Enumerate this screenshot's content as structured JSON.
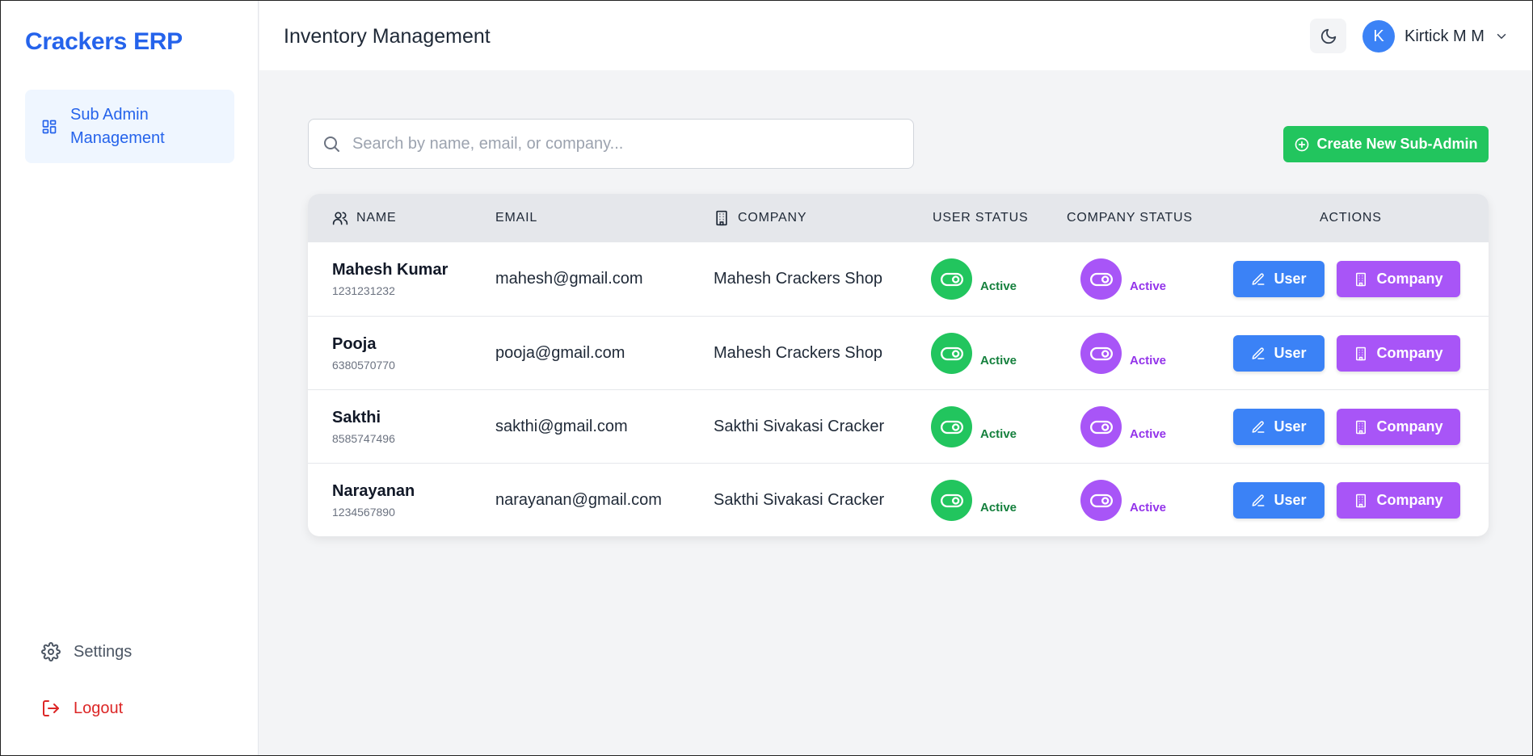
{
  "sidebar": {
    "brand": "Crackers ERP",
    "nav_label": "Sub Admin Management",
    "settings_label": "Settings",
    "logout_label": "Logout"
  },
  "header": {
    "title": "Inventory Management",
    "user_initial": "K",
    "user_name": "Kirtick M M"
  },
  "toolbar": {
    "search_placeholder": "Search by name, email, or company...",
    "search_value": "",
    "create_label": "Create New Sub-Admin"
  },
  "table": {
    "headers": {
      "name": "NAME",
      "email": "EMAIL",
      "company": "COMPANY",
      "user_status": "USER STATUS",
      "company_status": "COMPANY STATUS",
      "actions": "ACTIONS"
    },
    "user_button_label": "User",
    "company_button_label": "Company",
    "rows": [
      {
        "name": "Mahesh Kumar",
        "phone": "1231231232",
        "email": "mahesh@gmail.com",
        "company": "Mahesh Crackers Shop",
        "user_status": "Active",
        "company_status": "Active"
      },
      {
        "name": "Pooja",
        "phone": "6380570770",
        "email": "pooja@gmail.com",
        "company": "Mahesh Crackers Shop",
        "user_status": "Active",
        "company_status": "Active"
      },
      {
        "name": "Sakthi",
        "phone": "8585747496",
        "email": "sakthi@gmail.com",
        "company": "Sakthi Sivakasi Cracker",
        "user_status": "Active",
        "company_status": "Active"
      },
      {
        "name": "Narayanan",
        "phone": "1234567890",
        "email": "narayanan@gmail.com",
        "company": "Sakthi Sivakasi Cracker",
        "user_status": "Active",
        "company_status": "Active"
      }
    ]
  },
  "colors": {
    "brand": "#2563eb",
    "success": "#22c55e",
    "accent_purple": "#a855f7",
    "primary_blue": "#3b82f6",
    "danger": "#dc2626"
  },
  "icons": {
    "nav": "dashboard-icon",
    "settings": "gear-icon",
    "logout": "logout-icon",
    "theme": "moon-icon",
    "user_menu": "chevron-down-icon",
    "search": "search-icon",
    "create": "plus-circle-icon",
    "name_header": "users-icon",
    "company_header": "building-icon",
    "toggle": "toggle-icon",
    "user_button": "pencil-icon",
    "company_button": "building-icon"
  }
}
